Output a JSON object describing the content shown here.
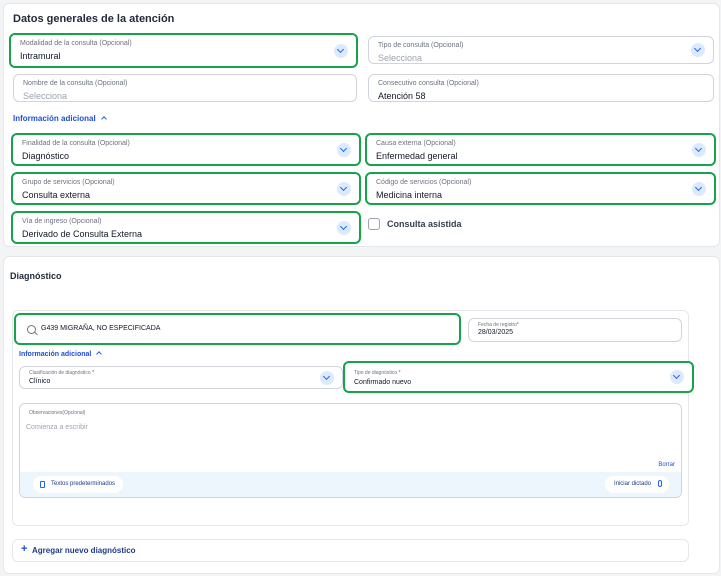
{
  "general": {
    "title": "Datos generales de la atención",
    "modalidad": {
      "label": "Modalidad de la consulta (Opcional)",
      "value": "Intramural"
    },
    "tipo_consulta": {
      "label": "Tipo de consulta (Opcional)",
      "placeholder": "Selecciona"
    },
    "nombre_consulta": {
      "label": "Nombre de la consulta (Opcional)",
      "placeholder": "Selecciona"
    },
    "consecutivo": {
      "label": "Consecutivo consulta (Opcional)",
      "value": "Atención 58"
    },
    "info_adicional": "Información adicional",
    "finalidad": {
      "label": "Finalidad de la consulta (Opcional)",
      "value": "Diagnóstico"
    },
    "causa_externa": {
      "label": "Causa externa (Opcional)",
      "value": "Enfermedad general"
    },
    "grupo_servicios": {
      "label": "Grupo de servicios (Opcional)",
      "value": "Consulta externa"
    },
    "codigo_servicios": {
      "label": "Código de servicios (Opcional)",
      "value": "Medicina interna"
    },
    "via_ingreso": {
      "label": "Vía de ingreso (Opcional)",
      "value": "Derivado de Consulta Externa"
    },
    "consulta_asistida": "Consulta asistida"
  },
  "diagnostico": {
    "title": "Diagnóstico",
    "search_value": "G439 MIGRAÑA, NO ESPECIFICADA",
    "fecha": {
      "label": "Fecha de registro",
      "required_mark": "*",
      "value": "28/03/2025"
    },
    "info_adicional": "Información adicional",
    "clasificacion": {
      "label": "Clasificación de diagnóstico",
      "required_mark": "*",
      "value": "Clínico"
    },
    "tipo_diagnostico": {
      "label": "Tipo de diagnóstico",
      "required_mark": "*",
      "value": "Confirmado nuevo"
    },
    "observaciones": {
      "label": "Observaciones(Opcional)",
      "placeholder": "Comienza a escribir"
    },
    "borrar": "Borrar",
    "textos_predeterminados": "Textos predeterminados",
    "iniciar_dictado": "Iniciar dictado",
    "agregar": "Agregar nuevo diagnóstico"
  },
  "colors": {
    "highlight": "#16a34a",
    "accent": "#1d4ed8",
    "chevron_bg": "#dbeafe"
  }
}
